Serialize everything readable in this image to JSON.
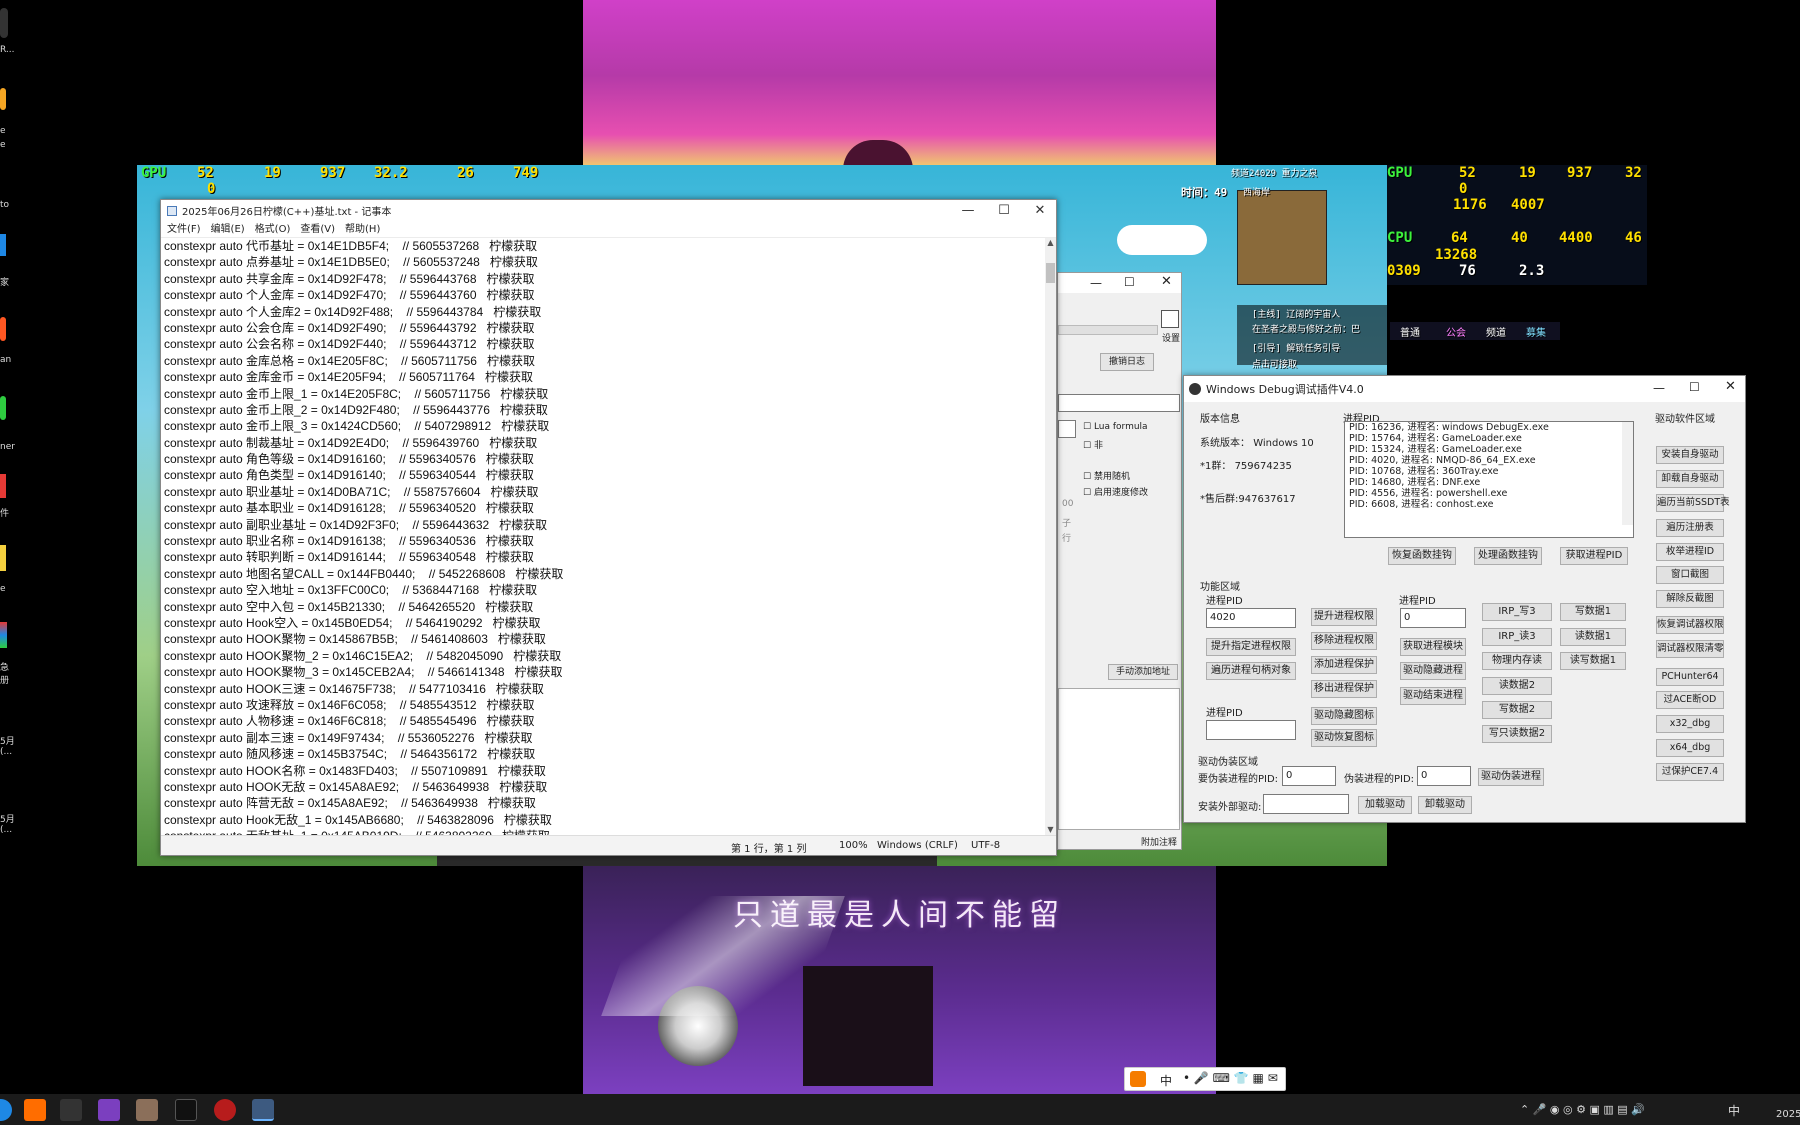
{
  "video": {
    "lyric": "只道最是人间不能留"
  },
  "game_hud": {
    "gpu_label": "GPU",
    "gpu_load": "52",
    "gpu_temp": "19",
    "gpu_clock": "937",
    "gpu_mhz_extra": "32.2",
    "temp2": "26",
    "mem": "749",
    "pct": "0",
    "right_gpu_load": "52",
    "right_gpu_temp": "19",
    "right_clock": "937",
    "right_last": "32",
    "right_pct": "0",
    "mem_val": "1176",
    "mem_val2": "4007",
    "cpu_temp": "64",
    "cpu_load": "40",
    "cpu_clock": "4400",
    "cpu_last": "46",
    "ram": "13268",
    "fps_time": "0309",
    "fps": "76",
    "fps_ms": "2.3",
    "time_text": "时间：49",
    "channel": "频道24029 重力之泉",
    "map_label": "西海岸",
    "quest1": "[主线] 辽阔的宇宙人",
    "quest2": "在圣者之殿与修好之前：巴",
    "quest3": "[引导] 解锁任务引导",
    "quest4": "点击可接取",
    "tab_normal": "普通",
    "tab_guild": "公会",
    "tab_channel": "频道",
    "tab_team": "募集"
  },
  "notepad": {
    "title": "2025年06月26日柠檬(C++)基址.txt - 记事本",
    "menu": [
      "文件(F)",
      "编辑(E)",
      "格式(O)",
      "查看(V)",
      "帮助(H)"
    ],
    "lines": [
      "constexpr auto 代币基址 = 0x14E1DB5F4;    // 5605537268   柠檬获取",
      "constexpr auto 点券基址 = 0x14E1DB5E0;    // 5605537248   柠檬获取",
      "constexpr auto 共享金库 = 0x14D92F478;    // 5596443768   柠檬获取",
      "constexpr auto 个人金库 = 0x14D92F470;    // 5596443760   柠檬获取",
      "constexpr auto 个人金库2 = 0x14D92F488;    // 5596443784   柠檬获取",
      "constexpr auto 公会仓库 = 0x14D92F490;    // 5596443792   柠檬获取",
      "constexpr auto 公会名称 = 0x14D92F440;    // 5596443712   柠檬获取",
      "constexpr auto 金库总格 = 0x14E205F8C;    // 5605711756   柠檬获取",
      "constexpr auto 金库金币 = 0x14E205F94;    // 5605711764   柠檬获取",
      "constexpr auto 金币上限_1 = 0x14E205F8C;    // 5605711756   柠檬获取",
      "constexpr auto 金币上限_2 = 0x14D92F480;    // 5596443776   柠檬获取",
      "constexpr auto 金币上限_3 = 0x1424CD560;    // 5407298912   柠檬获取",
      "constexpr auto 制裁基址 = 0x14D92E4D0;    // 5596439760   柠檬获取",
      "constexpr auto 角色等级 = 0x14D916160;    // 5596340576   柠檬获取",
      "constexpr auto 角色类型 = 0x14D916140;    // 5596340544   柠檬获取",
      "constexpr auto 职业基址 = 0x14D0BA71C;    // 5587576604   柠檬获取",
      "constexpr auto 基本职业 = 0x14D916128;    // 5596340520   柠檬获取",
      "constexpr auto 副职业基址 = 0x14D92F3F0;    // 5596443632   柠檬获取",
      "constexpr auto 职业名称 = 0x14D916138;    // 5596340536   柠檬获取",
      "constexpr auto 转职判断 = 0x14D916144;    // 5596340548   柠檬获取",
      "constexpr auto 地图名望CALL = 0x144FB0440;    // 5452268608   柠檬获取",
      "constexpr auto 空入地址 = 0x13FFC00C0;    // 5368447168   柠檬获取",
      "constexpr auto 空中入包 = 0x145B21330;    // 5464265520   柠檬获取",
      "constexpr auto Hook空入 = 0x145B0ED54;    // 5464190292   柠檬获取",
      "constexpr auto HOOK聚物 = 0x145867B5B;    // 5461408603   柠檬获取",
      "constexpr auto HOOK聚物_2 = 0x146C15EA2;    // 5482045090   柠檬获取",
      "constexpr auto HOOK聚物_3 = 0x145CEB2A4;    // 5466141348   柠檬获取",
      "constexpr auto HOOK三速 = 0x14675F738;    // 5477103416   柠檬获取",
      "constexpr auto 攻速释放 = 0x146F6C058;    // 5485543512   柠檬获取",
      "constexpr auto 人物移速 = 0x146F6C818;    // 5485545496   柠檬获取",
      "constexpr auto 副本三速 = 0x149F97434;    // 5536052276   柠檬获取",
      "constexpr auto 随风移速 = 0x145B3754C;    // 5464356172   柠檬获取",
      "constexpr auto HOOK名称 = 0x1483FD403;    // 5507109891   柠檬获取",
      "constexpr auto HOOK无敌 = 0x145A8AE92;    // 5463649938   柠檬获取",
      "constexpr auto 阵营无敌 = 0x145A8AE92;    // 5463649938   柠檬获取",
      "constexpr auto Hook无敌_1 = 0x145AB6680;    // 5463828096   柠檬获取",
      "constexpr auto 无敌基址_1 = 0x145AB019D;    // 5463802269   柠檬获取"
    ],
    "status": {
      "position": "第 1 行，第 1 列",
      "zoom": "100%",
      "line_ending": "Windows (CRLF)",
      "encoding": "UTF-8"
    }
  },
  "cheat_tool": {
    "settings_label": "设置",
    "cancel_log": "撤销日志",
    "lua_formula": "Lua formula",
    "not_label": "非",
    "disable_random": "禁用随机",
    "enable_speed": "启用速度修改",
    "manual_add": "手动添加地址",
    "add_note": "附加注释",
    "val_00": "00",
    "label_zi": "子",
    "label_hang": "行"
  },
  "debug_tool": {
    "title": "Windows Debug调试插件V4.0",
    "version_group": "版本信息",
    "sys_version_label": "系统版本：",
    "sys_version": "Windows 10",
    "group1_label": "*1群：",
    "group1": "759674235",
    "after_sale_label": "*售后群:",
    "after_sale": "947637617",
    "process_pid_group": "进程PID",
    "pid_lines": [
      "PID: 16236, 进程名: windows DebugEx.exe",
      "PID: 15764, 进程名: GameLoader.exe",
      "PID: 15324, 进程名: GameLoader.exe",
      "PID: 4020, 进程名: NMQD-86_64_EX.exe",
      "PID: 10768, 进程名: 360Tray.exe",
      "PID: 14680, 进程名: DNF.exe",
      "PID: 4556, 进程名: powershell.exe",
      "PID: 6608, 进程名: conhost.exe"
    ],
    "btn_restore_hook": "恢复函数挂钩",
    "btn_handle_hook": "处理函数挂钩",
    "btn_get_pid": "获取进程PID",
    "func_group": "功能区域",
    "pid_label_1": "进程PID",
    "pid_value_1": "4020",
    "pid_label_2": "进程PID",
    "pid_value_2": "0",
    "btn_raise_priv": "提升进程权限",
    "btn_remove_priv": "移除进程权限",
    "btn_raise_specific": "提升指定进程权限",
    "btn_add_protect": "添加进程保护",
    "btn_enum_handles": "遍历进程句柄对象",
    "btn_remove_protect": "移出进程保护",
    "btn_get_module": "获取进程模块",
    "btn_hide_proc": "驱动隐藏进程",
    "btn_end_proc": "驱动结束进程",
    "btn_irp_write": "IRP_写3",
    "btn_irp_read": "IRP_读3",
    "btn_write1": "写数据1",
    "btn_read1": "读数据1",
    "btn_phys_read": "物理内存读",
    "btn_rw1": "读写数据1",
    "btn_read2": "读数据2",
    "btn_write2": "写数据2",
    "btn_write_read2": "写只读数据2",
    "pid_label_3": "进程PID",
    "btn_hide_icon": "驱动隐藏图标",
    "btn_restore_icon": "驱动恢复图标",
    "disguise_group": "驱动伪装区域",
    "disguise_label": "要伪装进程的PID:",
    "disguise_value": "0",
    "fake_label": "伪装进程的PID:",
    "fake_value": "0",
    "btn_disguise": "驱动伪装进程",
    "install_ext_label": "安装外部驱动:",
    "btn_load_driver": "加载驱动",
    "btn_unload_driver": "卸载驱动",
    "driver_group": "驱动软件区域",
    "side_buttons": [
      "安装自身驱动",
      "卸载自身驱动",
      "遍历当前SSDT表",
      "遍历注册表",
      "枚举进程ID",
      "窗口截图",
      "解除反截图",
      "恢复调试器权限",
      "调试器权限清零",
      "PCHunter64",
      "过ACE断OD",
      "x32_dbg",
      "x64_dbg",
      "过保护CE7.4"
    ]
  },
  "taskbar": {
    "ime_label": "中",
    "tray_lang": "中",
    "clock": "2025/"
  },
  "desktop": {
    "labels": [
      "R...",
      "e",
      "e",
      "to",
      "家",
      "an",
      "ner",
      "件",
      "e",
      "急\n册",
      "5月\n(...",
      "5月\n(..."
    ]
  }
}
